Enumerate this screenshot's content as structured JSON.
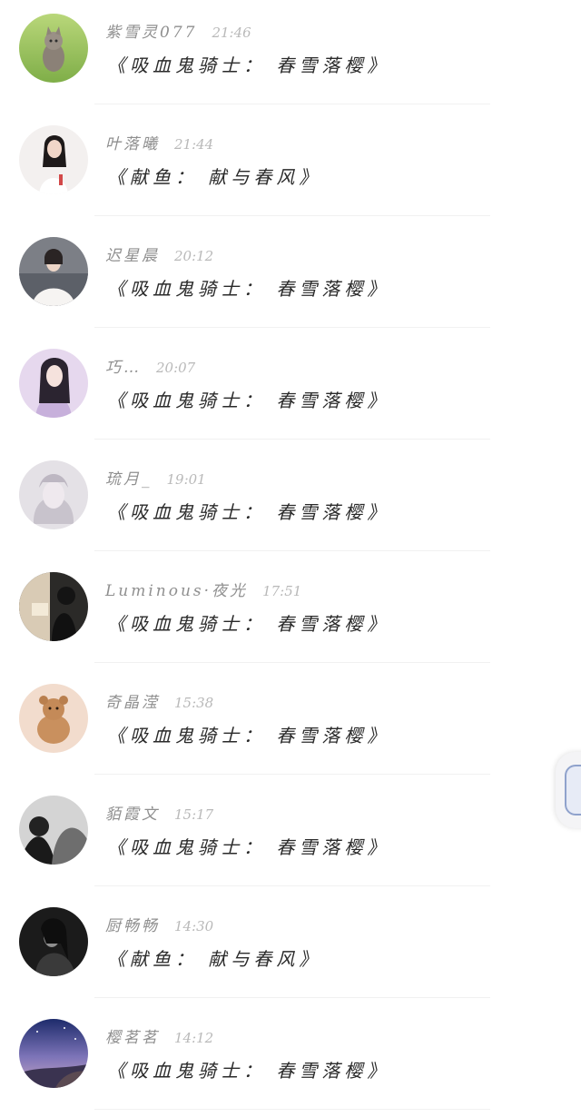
{
  "comments": [
    {
      "name": "紫雪灵077",
      "time": "21:46",
      "text": "《吸血鬼骑士： 春雪落樱》",
      "avatar": "kitten-on-grass"
    },
    {
      "name": "叶落曦",
      "time": "21:44",
      "text": "《献鱼： 献与春风》",
      "avatar": "woman-portrait-white-dress"
    },
    {
      "name": "迟星晨",
      "time": "20:12",
      "text": "《吸血鬼骑士： 春雪落樱》",
      "avatar": "woman-white-dress-landscape"
    },
    {
      "name": "巧…",
      "time": "20:07",
      "text": "《吸血鬼骑士： 春雪落樱》",
      "avatar": "anime-girl-lilac"
    },
    {
      "name": "琉月_",
      "time": "19:01",
      "text": "《吸血鬼骑士： 春雪落樱》",
      "avatar": "pale-anime-girl-gray"
    },
    {
      "name": "Luminous·夜光",
      "time": "17:51",
      "text": "《吸血鬼骑士： 春雪落樱》",
      "avatar": "reading-silhouette"
    },
    {
      "name": "奇晶滢",
      "time": "15:38",
      "text": "《吸血鬼骑士： 春雪落樱》",
      "avatar": "teddy-bear"
    },
    {
      "name": "貊霞文",
      "time": "15:17",
      "text": "《吸血鬼骑士： 春雪落樱》",
      "avatar": "couple-monochrome"
    },
    {
      "name": "厨畅畅",
      "time": "14:30",
      "text": "《献鱼： 献与春风》",
      "avatar": "woman-dark-monochrome"
    },
    {
      "name": "樱茗茗",
      "time": "14:12",
      "text": "《吸血鬼骑士： 春雪落樱》",
      "avatar": "night-sky-seaside"
    }
  ],
  "colors": {
    "name": "#8f8f8f",
    "time": "#b9b9b9",
    "message": "#2a2a2a",
    "divider": "#f1f1f1",
    "edge_handle_border": "#8fa2cc"
  }
}
